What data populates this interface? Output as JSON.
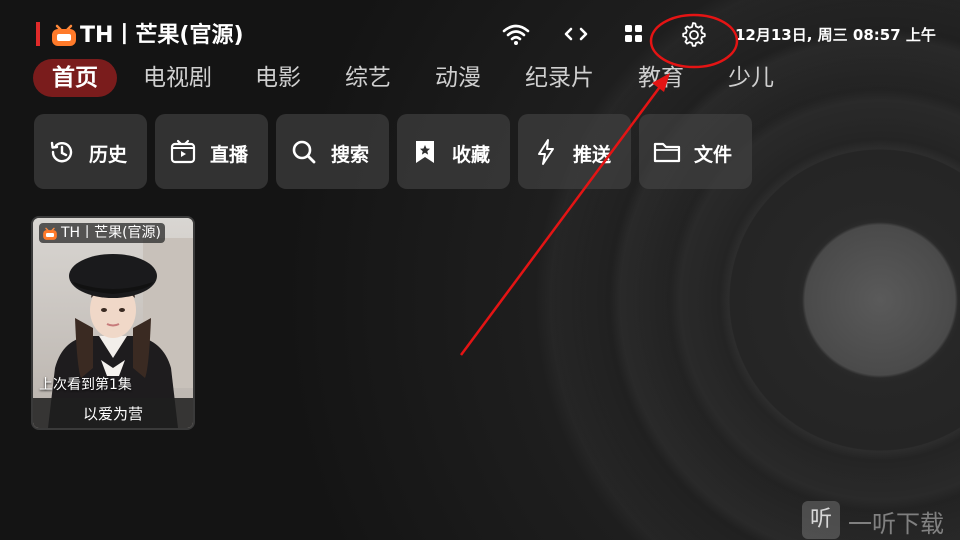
{
  "header": {
    "app_title": "TH丨芒果(官源)",
    "datetime": "12月13日, 周三 08:57 上午",
    "icons": [
      "wifi-icon",
      "code-arrows-icon",
      "apps-grid-icon",
      "settings-gear-icon"
    ],
    "accent_color": "#e02a2a"
  },
  "nav": {
    "items": [
      {
        "label": "首页",
        "active": true
      },
      {
        "label": "电视剧",
        "active": false
      },
      {
        "label": "电影",
        "active": false
      },
      {
        "label": "综艺",
        "active": false
      },
      {
        "label": "动漫",
        "active": false
      },
      {
        "label": "纪录片",
        "active": false
      },
      {
        "label": "教育",
        "active": false
      },
      {
        "label": "少儿",
        "active": false
      }
    ]
  },
  "actions": [
    {
      "label": "历史",
      "icon": "history-icon"
    },
    {
      "label": "直播",
      "icon": "live-tv-icon"
    },
    {
      "label": "搜索",
      "icon": "search-icon"
    },
    {
      "label": "收藏",
      "icon": "bookmark-star-icon"
    },
    {
      "label": "推送",
      "icon": "lightning-icon"
    },
    {
      "label": "文件",
      "icon": "folder-icon"
    }
  ],
  "history_card": {
    "badge": "TH丨芒果(官源)",
    "progress": "上次看到第1集",
    "title": "以爱为营"
  },
  "watermark": {
    "box_char": "听",
    "text": "一听下载"
  }
}
